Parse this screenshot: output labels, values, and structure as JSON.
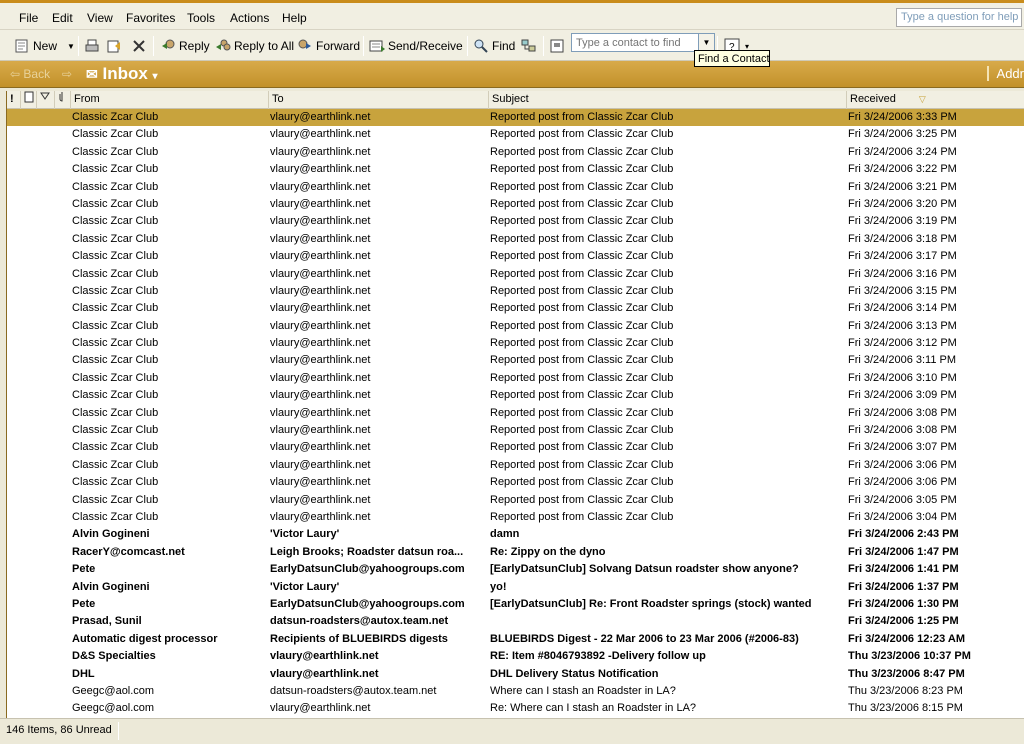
{
  "menu": {
    "items": [
      "File",
      "Edit",
      "View",
      "Favorites",
      "Tools",
      "Actions",
      "Help"
    ],
    "help_placeholder": "Type a question for help"
  },
  "toolbar": {
    "new_label": "New",
    "reply_label": "Reply",
    "reply_all_label": "Reply to All",
    "forward_label": "Forward",
    "send_receive_label": "Send/Receive",
    "find_label": "Find",
    "contact_placeholder": "Type a contact to find",
    "tooltip": "Find a Contact"
  },
  "nav": {
    "back_label": "Back",
    "folder_title": "Inbox",
    "address_label": "Addr"
  },
  "columns": {
    "from": "From",
    "to": "To",
    "subject": "Subject",
    "received": "Received"
  },
  "messages": [
    {
      "from": "Classic Zcar Club",
      "to": "vlaury@earthlink.net",
      "subject": "Reported post from Classic Zcar Club",
      "received": "Fri 3/24/2006 3:33 PM",
      "unread": false,
      "selected": true
    },
    {
      "from": "Classic Zcar Club",
      "to": "vlaury@earthlink.net",
      "subject": "Reported post from Classic Zcar Club",
      "received": "Fri 3/24/2006 3:25 PM",
      "unread": false
    },
    {
      "from": "Classic Zcar Club",
      "to": "vlaury@earthlink.net",
      "subject": "Reported post from Classic Zcar Club",
      "received": "Fri 3/24/2006 3:24 PM",
      "unread": false
    },
    {
      "from": "Classic Zcar Club",
      "to": "vlaury@earthlink.net",
      "subject": "Reported post from Classic Zcar Club",
      "received": "Fri 3/24/2006 3:22 PM",
      "unread": false
    },
    {
      "from": "Classic Zcar Club",
      "to": "vlaury@earthlink.net",
      "subject": "Reported post from Classic Zcar Club",
      "received": "Fri 3/24/2006 3:21 PM",
      "unread": false
    },
    {
      "from": "Classic Zcar Club",
      "to": "vlaury@earthlink.net",
      "subject": "Reported post from Classic Zcar Club",
      "received": "Fri 3/24/2006 3:20 PM",
      "unread": false
    },
    {
      "from": "Classic Zcar Club",
      "to": "vlaury@earthlink.net",
      "subject": "Reported post from Classic Zcar Club",
      "received": "Fri 3/24/2006 3:19 PM",
      "unread": false
    },
    {
      "from": "Classic Zcar Club",
      "to": "vlaury@earthlink.net",
      "subject": "Reported post from Classic Zcar Club",
      "received": "Fri 3/24/2006 3:18 PM",
      "unread": false
    },
    {
      "from": "Classic Zcar Club",
      "to": "vlaury@earthlink.net",
      "subject": "Reported post from Classic Zcar Club",
      "received": "Fri 3/24/2006 3:17 PM",
      "unread": false
    },
    {
      "from": "Classic Zcar Club",
      "to": "vlaury@earthlink.net",
      "subject": "Reported post from Classic Zcar Club",
      "received": "Fri 3/24/2006 3:16 PM",
      "unread": false
    },
    {
      "from": "Classic Zcar Club",
      "to": "vlaury@earthlink.net",
      "subject": "Reported post from Classic Zcar Club",
      "received": "Fri 3/24/2006 3:15 PM",
      "unread": false
    },
    {
      "from": "Classic Zcar Club",
      "to": "vlaury@earthlink.net",
      "subject": "Reported post from Classic Zcar Club",
      "received": "Fri 3/24/2006 3:14 PM",
      "unread": false
    },
    {
      "from": "Classic Zcar Club",
      "to": "vlaury@earthlink.net",
      "subject": "Reported post from Classic Zcar Club",
      "received": "Fri 3/24/2006 3:13 PM",
      "unread": false
    },
    {
      "from": "Classic Zcar Club",
      "to": "vlaury@earthlink.net",
      "subject": "Reported post from Classic Zcar Club",
      "received": "Fri 3/24/2006 3:12 PM",
      "unread": false
    },
    {
      "from": "Classic Zcar Club",
      "to": "vlaury@earthlink.net",
      "subject": "Reported post from Classic Zcar Club",
      "received": "Fri 3/24/2006 3:11 PM",
      "unread": false
    },
    {
      "from": "Classic Zcar Club",
      "to": "vlaury@earthlink.net",
      "subject": "Reported post from Classic Zcar Club",
      "received": "Fri 3/24/2006 3:10 PM",
      "unread": false
    },
    {
      "from": "Classic Zcar Club",
      "to": "vlaury@earthlink.net",
      "subject": "Reported post from Classic Zcar Club",
      "received": "Fri 3/24/2006 3:09 PM",
      "unread": false
    },
    {
      "from": "Classic Zcar Club",
      "to": "vlaury@earthlink.net",
      "subject": "Reported post from Classic Zcar Club",
      "received": "Fri 3/24/2006 3:08 PM",
      "unread": false
    },
    {
      "from": "Classic Zcar Club",
      "to": "vlaury@earthlink.net",
      "subject": "Reported post from Classic Zcar Club",
      "received": "Fri 3/24/2006 3:08 PM",
      "unread": false
    },
    {
      "from": "Classic Zcar Club",
      "to": "vlaury@earthlink.net",
      "subject": "Reported post from Classic Zcar Club",
      "received": "Fri 3/24/2006 3:07 PM",
      "unread": false
    },
    {
      "from": "Classic Zcar Club",
      "to": "vlaury@earthlink.net",
      "subject": "Reported post from Classic Zcar Club",
      "received": "Fri 3/24/2006 3:06 PM",
      "unread": false
    },
    {
      "from": "Classic Zcar Club",
      "to": "vlaury@earthlink.net",
      "subject": "Reported post from Classic Zcar Club",
      "received": "Fri 3/24/2006 3:06 PM",
      "unread": false
    },
    {
      "from": "Classic Zcar Club",
      "to": "vlaury@earthlink.net",
      "subject": "Reported post from Classic Zcar Club",
      "received": "Fri 3/24/2006 3:05 PM",
      "unread": false
    },
    {
      "from": "Classic Zcar Club",
      "to": "vlaury@earthlink.net",
      "subject": "Reported post from Classic Zcar Club",
      "received": "Fri 3/24/2006 3:04 PM",
      "unread": false
    },
    {
      "from": "Alvin Gogineni",
      "to": "'Victor Laury'",
      "subject": "damn",
      "received": "Fri 3/24/2006 2:43 PM",
      "unread": true
    },
    {
      "from": "RacerY@comcast.net",
      "to": "Leigh Brooks; Roadster datsun roa...",
      "subject": "Re: Zippy on the dyno",
      "received": "Fri 3/24/2006 1:47 PM",
      "unread": true
    },
    {
      "from": "Pete",
      "to": "EarlyDatsunClub@yahoogroups.com",
      "subject": "[EarlyDatsunClub] Solvang Datsun roadster show anyone?",
      "received": "Fri 3/24/2006 1:41 PM",
      "unread": true
    },
    {
      "from": "Alvin Gogineni",
      "to": "'Victor Laury'",
      "subject": "yo!",
      "received": "Fri 3/24/2006 1:37 PM",
      "unread": true
    },
    {
      "from": "Pete",
      "to": "EarlyDatsunClub@yahoogroups.com",
      "subject": "[EarlyDatsunClub] Re: Front Roadster springs (stock) wanted",
      "received": "Fri 3/24/2006 1:30 PM",
      "unread": true
    },
    {
      "from": "Prasad, Sunil",
      "to": "datsun-roadsters@autox.team.net",
      "subject": "",
      "received": "Fri 3/24/2006 1:25 PM",
      "unread": true
    },
    {
      "from": "Automatic digest processor",
      "to": "Recipients of BLUEBIRDS digests",
      "subject": "BLUEBIRDS Digest - 22 Mar 2006 to 23 Mar 2006 (#2006-83)",
      "received": "Fri 3/24/2006 12:23 AM",
      "unread": true
    },
    {
      "from": "D&S Specialties",
      "to": "vlaury@earthlink.net",
      "subject": "RE: Item #8046793892 -Delivery follow up",
      "received": "Thu 3/23/2006 10:37 PM",
      "unread": true
    },
    {
      "from": "DHL",
      "to": "vlaury@earthlink.net",
      "subject": "DHL Delivery Status Notification",
      "received": "Thu 3/23/2006 8:47 PM",
      "unread": true
    },
    {
      "from": "Geegc@aol.com",
      "to": "datsun-roadsters@autox.team.net",
      "subject": "Where can I stash an Roadster in LA?",
      "received": "Thu 3/23/2006 8:23 PM",
      "unread": false
    },
    {
      "from": "Geegc@aol.com",
      "to": "vlaury@earthlink.net",
      "subject": "Re: Where can I stash an Roadster in LA?",
      "received": "Thu 3/23/2006 8:15 PM",
      "unread": false
    }
  ],
  "status": {
    "text": "146 Items, 86 Unread"
  },
  "colors": {
    "accent": "#c8a33d",
    "navbar": "#c99a33",
    "chrome": "#ece9d8"
  }
}
